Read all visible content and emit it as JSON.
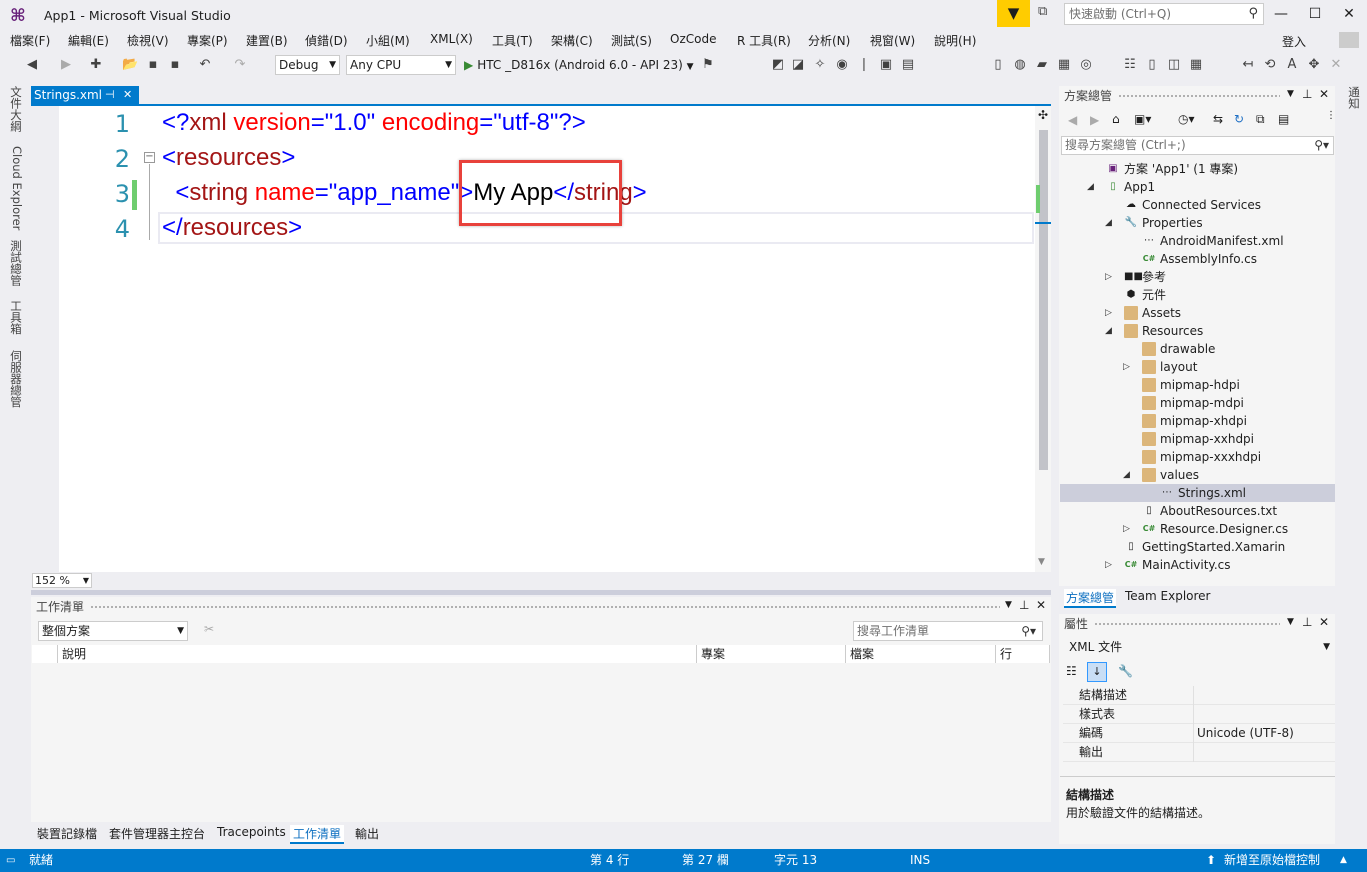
{
  "window": {
    "title": "App1 - Microsoft Visual Studio",
    "quick_launch_placeholder": "快速啟動 (Ctrl+Q)",
    "signin": "登入"
  },
  "menu": [
    "檔案(F)",
    "編輯(E)",
    "檢視(V)",
    "專案(P)",
    "建置(B)",
    "偵錯(D)",
    "小組(M)",
    "XML(X)",
    "工具(T)",
    "架構(C)",
    "測試(S)",
    "OzCode",
    "R 工具(R)",
    "分析(N)",
    "視窗(W)",
    "說明(H)"
  ],
  "toolbar": {
    "config": "Debug",
    "platform": "Any CPU",
    "run_target": "HTC _D816x (Android 6.0 - API 23)"
  },
  "left_tabs": [
    "文件大綱",
    "Cloud Explorer",
    "測試總管",
    "工具箱",
    "伺服器總管"
  ],
  "editor": {
    "tab_label": "Strings.xml",
    "zoom": "152 %",
    "lines": [
      {
        "num": "1",
        "tokens": [
          [
            "<?",
            "blue"
          ],
          [
            "xml",
            "mar"
          ],
          [
            " version",
            "red"
          ],
          [
            "=",
            "blue"
          ],
          [
            "\"1.0\"",
            "blue"
          ],
          [
            " encoding",
            "red"
          ],
          [
            "=",
            "blue"
          ],
          [
            "\"utf-8\"",
            "blue"
          ],
          [
            "?>",
            "blue"
          ]
        ]
      },
      {
        "num": "2",
        "tokens": [
          [
            "<",
            "blue"
          ],
          [
            "resources",
            "mar"
          ],
          [
            ">",
            "blue"
          ]
        ]
      },
      {
        "num": "3",
        "tokens": [
          [
            "  <",
            "blue"
          ],
          [
            "string",
            "mar"
          ],
          [
            " name",
            "red"
          ],
          [
            "=",
            "blue"
          ],
          [
            "\"app_name\"",
            "blue"
          ],
          [
            ">",
            "blue"
          ],
          [
            "My App",
            "blk"
          ],
          [
            "</",
            "blue"
          ],
          [
            "string",
            "mar"
          ],
          [
            ">",
            "blue"
          ]
        ]
      },
      {
        "num": "4",
        "tokens": [
          [
            "</",
            "blue"
          ],
          [
            "resources",
            "mar"
          ],
          [
            ">",
            "blue"
          ]
        ]
      }
    ]
  },
  "task_list": {
    "title": "工作清單",
    "scope": "整個方案",
    "search_placeholder": "搜尋工作清單",
    "columns": [
      "說明",
      "專案",
      "檔案",
      "行"
    ]
  },
  "bottom_tabs": [
    "裝置記錄檔",
    "套件管理器主控台",
    "Tracepoints",
    "工作清單",
    "輸出"
  ],
  "solution_explorer": {
    "title": "方案總管",
    "search_placeholder": "搜尋方案總管 (Ctrl+;)",
    "tree": [
      {
        "label": "方案 'App1' (1 專案)",
        "depth": 0,
        "twisty": "",
        "icon": "solution"
      },
      {
        "label": "App1",
        "depth": 0,
        "twisty": "open",
        "icon": "project",
        "bold": true
      },
      {
        "label": "Connected Services",
        "depth": 1,
        "twisty": "",
        "icon": "cloud"
      },
      {
        "label": "Properties",
        "depth": 1,
        "twisty": "open",
        "icon": "wrench"
      },
      {
        "label": "AndroidManifest.xml",
        "depth": 2,
        "twisty": "",
        "icon": "xml"
      },
      {
        "label": "AssemblyInfo.cs",
        "depth": 2,
        "twisty": "",
        "icon": "cs"
      },
      {
        "label": "參考",
        "depth": 1,
        "twisty": "closed",
        "icon": "ref"
      },
      {
        "label": "元件",
        "depth": 1,
        "twisty": "",
        "icon": "component"
      },
      {
        "label": "Assets",
        "depth": 1,
        "twisty": "closed",
        "icon": "folder"
      },
      {
        "label": "Resources",
        "depth": 1,
        "twisty": "open",
        "icon": "folder-open"
      },
      {
        "label": "drawable",
        "depth": 2,
        "twisty": "",
        "icon": "folder"
      },
      {
        "label": "layout",
        "depth": 2,
        "twisty": "closed",
        "icon": "folder"
      },
      {
        "label": "mipmap-hdpi",
        "depth": 2,
        "twisty": "",
        "icon": "folder"
      },
      {
        "label": "mipmap-mdpi",
        "depth": 2,
        "twisty": "",
        "icon": "folder"
      },
      {
        "label": "mipmap-xhdpi",
        "depth": 2,
        "twisty": "",
        "icon": "folder"
      },
      {
        "label": "mipmap-xxhdpi",
        "depth": 2,
        "twisty": "",
        "icon": "folder"
      },
      {
        "label": "mipmap-xxxhdpi",
        "depth": 2,
        "twisty": "",
        "icon": "folder"
      },
      {
        "label": "values",
        "depth": 2,
        "twisty": "open",
        "icon": "folder-open"
      },
      {
        "label": "Strings.xml",
        "depth": 3,
        "twisty": "",
        "icon": "xml",
        "selected": true
      },
      {
        "label": "AboutResources.txt",
        "depth": 2,
        "twisty": "",
        "icon": "txt"
      },
      {
        "label": "Resource.Designer.cs",
        "depth": 2,
        "twisty": "closed",
        "icon": "cs"
      },
      {
        "label": "GettingStarted.Xamarin",
        "depth": 1,
        "twisty": "",
        "icon": "file"
      },
      {
        "label": "MainActivity.cs",
        "depth": 1,
        "twisty": "closed",
        "icon": "cs"
      }
    ],
    "tabs": [
      "方案總管",
      "Team Explorer"
    ]
  },
  "properties": {
    "title": "屬性",
    "object": "XML 文件",
    "rows": [
      {
        "key": "結構描述",
        "value": ""
      },
      {
        "key": "樣式表",
        "value": ""
      },
      {
        "key": "編碼",
        "value": "Unicode (UTF-8)"
      },
      {
        "key": "輸出",
        "value": ""
      }
    ],
    "desc_title": "結構描述",
    "desc_text": "用於驗證文件的結構描述。"
  },
  "status": {
    "ready": "就緒",
    "line": "第 4 行",
    "col": "第 27 欄",
    "char": "字元 13",
    "mode": "INS",
    "source_control": "新增至原始檔控制"
  },
  "right_edge_tab": "通知",
  "colors": {
    "accent": "#007acc",
    "highlight_box": "#e8413b",
    "filter_yellow": "#ffcc00"
  }
}
